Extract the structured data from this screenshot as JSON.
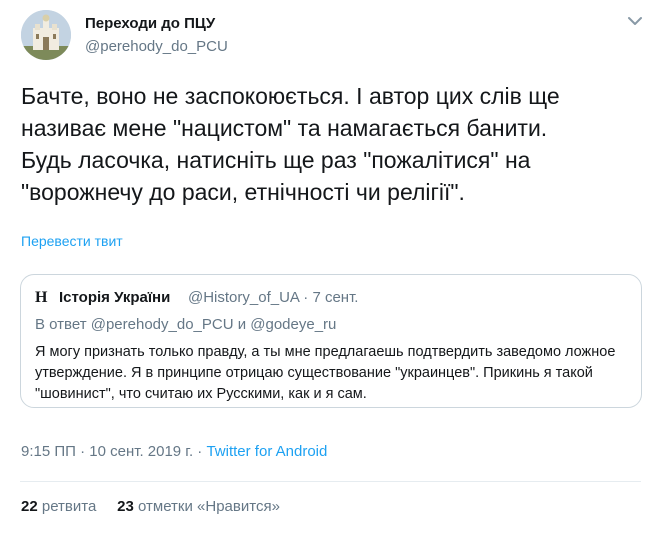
{
  "author": {
    "name": "Переходи до ПЦУ",
    "handle": "@perehody_do_PCU"
  },
  "tweet_text": "Бачте, воно не заспокоюється. І автор цих слів ще\nназиває мене \"нацистом\" та намагається банити.\nБудь ласочка, натисніть ще раз \"пожалітися\" на\n\"ворожнечу до раси, етнічності чи релігії\".",
  "translate_link": "Перевести твит",
  "quote": {
    "logo": "H",
    "name": "Історія України",
    "handle": "@History_of_UA",
    "separator": " · ",
    "date": "7 сент.",
    "reply_to": "В ответ @perehody_do_PCU и @godeye_ru",
    "text": "Я могу признать только правду, а ты мне предлагаешь подтвердить заведомо ложное утверждение. Я в принципе отрицаю существование \"украинцев\". Прикинь я такой \"шовинист\", что считаю их Русскими, как и я сам."
  },
  "timestamp": "9:15 ПП · 10 сент. 2019 г.",
  "timestamp_sep": " · ",
  "source": "Twitter for Android",
  "stats": {
    "retweets_count": "22",
    "retweets_label": "ретвита",
    "likes_count": "23",
    "likes_label": "отметки «Нравится»"
  },
  "icons": {
    "avatar": "church-avatar",
    "menu": "chevron-down-icon"
  }
}
